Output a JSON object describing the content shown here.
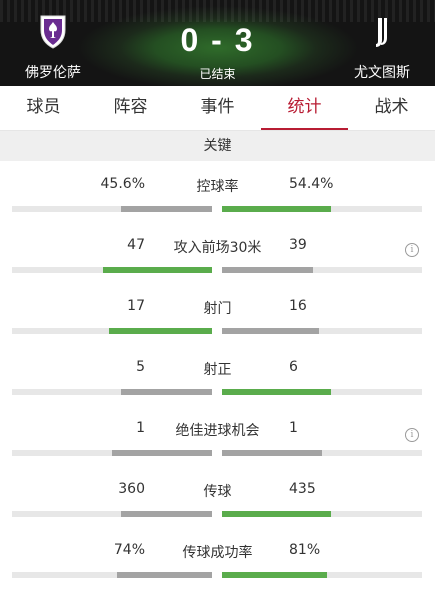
{
  "match": {
    "home_team": "佛罗伦萨",
    "away_team": "尤文图斯",
    "score": "0 - 3",
    "status": "已结束"
  },
  "tabs": [
    {
      "label": "球员",
      "active": false
    },
    {
      "label": "阵容",
      "active": false
    },
    {
      "label": "事件",
      "active": false
    },
    {
      "label": "统计",
      "active": true
    },
    {
      "label": "战术",
      "active": false
    }
  ],
  "section_title": "关键",
  "colors": {
    "accent": "#b81c33",
    "winner_bar": "#5aac4c",
    "loser_bar": "#a3a3a3",
    "track": "#e7e7e7"
  },
  "stats": [
    {
      "label": "控球率",
      "home": "45.6%",
      "away": "54.4%",
      "home_frac": 0.456,
      "away_frac": 0.544,
      "leader": "away",
      "info": false
    },
    {
      "label": "攻入前场30米",
      "home": "47",
      "away": "39",
      "home_frac": 0.546,
      "away_frac": 0.453,
      "leader": "home",
      "info": true
    },
    {
      "label": "射门",
      "home": "17",
      "away": "16",
      "home_frac": 0.515,
      "away_frac": 0.485,
      "leader": "home",
      "info": false
    },
    {
      "label": "射正",
      "home": "5",
      "away": "6",
      "home_frac": 0.455,
      "away_frac": 0.545,
      "leader": "away",
      "info": false
    },
    {
      "label": "绝佳进球机会",
      "home": "1",
      "away": "1",
      "home_frac": 0.5,
      "away_frac": 0.5,
      "leader": "none",
      "info": true
    },
    {
      "label": "传球",
      "home": "360",
      "away": "435",
      "home_frac": 0.453,
      "away_frac": 0.547,
      "leader": "away",
      "info": false
    },
    {
      "label": "传球成功率",
      "home": "74%",
      "away": "81%",
      "home_frac": 0.477,
      "away_frac": 0.523,
      "leader": "away",
      "info": false
    }
  ]
}
